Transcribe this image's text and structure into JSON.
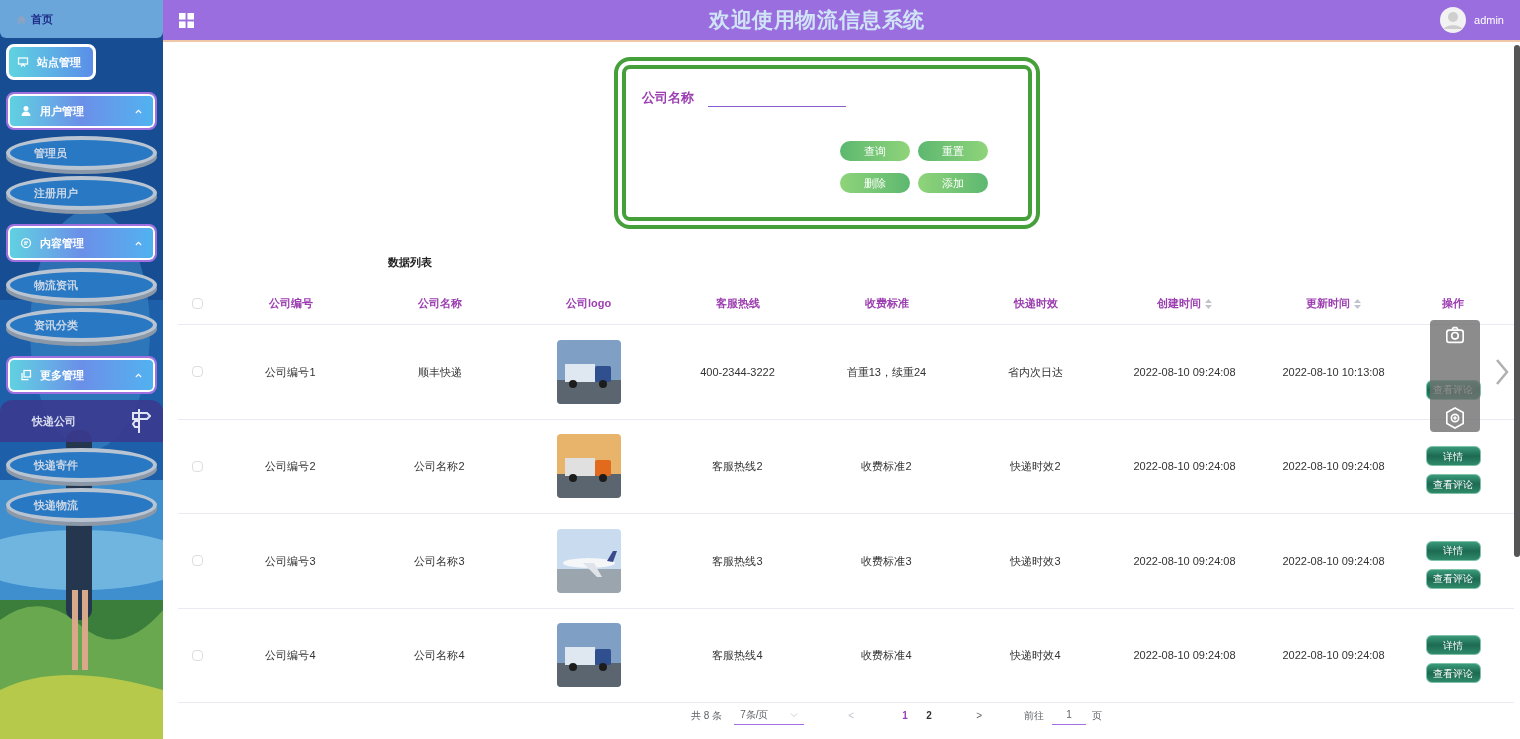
{
  "sidebar": {
    "home": "首页",
    "items": [
      {
        "kind": "link",
        "label": "站点管理"
      },
      {
        "kind": "group",
        "label": "用户管理",
        "expanded": true,
        "children": [
          {
            "label": "管理员",
            "selected": false
          },
          {
            "label": "注册用户",
            "selected": false
          }
        ]
      },
      {
        "kind": "group",
        "label": "内容管理",
        "expanded": true,
        "children": [
          {
            "label": "物流资讯",
            "selected": false
          },
          {
            "label": "资讯分类",
            "selected": false
          }
        ]
      },
      {
        "kind": "group",
        "label": "更多管理",
        "expanded": true,
        "children": [
          {
            "label": "快递公司",
            "selected": true
          },
          {
            "label": "快递寄件",
            "selected": false
          },
          {
            "label": "快递物流",
            "selected": false
          }
        ]
      }
    ]
  },
  "header": {
    "title": "欢迎使用物流信息系统",
    "user": "admin"
  },
  "search": {
    "label": "公司名称",
    "buttons": [
      "查询",
      "重置",
      "删除",
      "添加"
    ]
  },
  "list_title": "数据列表",
  "table": {
    "all_checked": false,
    "columns": [
      {
        "label": "公司编号",
        "sortable": false
      },
      {
        "label": "公司名称",
        "sortable": false
      },
      {
        "label": "公司logo",
        "sortable": false
      },
      {
        "label": "客服热线",
        "sortable": false
      },
      {
        "label": "收费标准",
        "sortable": false
      },
      {
        "label": "快递时效",
        "sortable": false
      },
      {
        "label": "创建时间",
        "sortable": true
      },
      {
        "label": "更新时间",
        "sortable": true
      },
      {
        "label": "操作",
        "sortable": false
      }
    ],
    "rows": [
      {
        "checked": false,
        "company_no": "公司编号1",
        "company_name": "顺丰快递",
        "logo": {
          "kind": "picture"
        },
        "hotline": "400-2344-3222",
        "fee": "首重13，续重24",
        "delivery_time": "省内次日达",
        "created": "2022-08-10 09:24:08",
        "updated": "2022-08-10 10:13:08",
        "actions": [
          "查看评论"
        ]
      },
      {
        "checked": false,
        "company_no": "公司编号2",
        "company_name": "公司名称2",
        "logo": {
          "kind": "picture"
        },
        "hotline": "客服热线2",
        "fee": "收费标准2",
        "delivery_time": "快递时效2",
        "created": "2022-08-10 09:24:08",
        "updated": "2022-08-10 09:24:08",
        "actions": [
          "详情",
          "查看评论"
        ]
      },
      {
        "checked": false,
        "company_no": "公司编号3",
        "company_name": "公司名称3",
        "logo": {
          "kind": "picture"
        },
        "hotline": "客服热线3",
        "fee": "收费标准3",
        "delivery_time": "快递时效3",
        "created": "2022-08-10 09:24:08",
        "updated": "2022-08-10 09:24:08",
        "actions": [
          "详情",
          "查看评论"
        ]
      },
      {
        "checked": false,
        "company_no": "公司编号4",
        "company_name": "公司名称4",
        "logo": {
          "kind": "picture"
        },
        "hotline": "客服热线4",
        "fee": "收费标准4",
        "delivery_time": "快递时效4",
        "created": "2022-08-10 09:24:08",
        "updated": "2022-08-10 09:24:08",
        "actions": [
          "详情",
          "查看评论"
        ]
      }
    ]
  },
  "pagination": {
    "total": "共 8 条",
    "page_size": "7条/页",
    "prev": "<",
    "pages": [
      {
        "label": "1",
        "selected": true
      },
      {
        "label": "2",
        "selected": false
      }
    ],
    "next": ">",
    "goto_label": "前往",
    "goto_value": "1",
    "goto_suffix": "页"
  }
}
